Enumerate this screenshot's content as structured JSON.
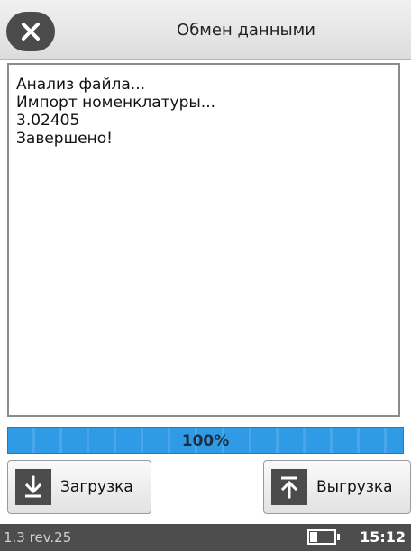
{
  "header": {
    "title": "Обмен данными",
    "close_icon": "close-icon"
  },
  "log": {
    "lines": [
      "Анализ файла...",
      "Импорт номенклатуры...",
      "3.02405",
      "Завершено!"
    ]
  },
  "progress": {
    "value": 100,
    "label": "100%",
    "color": "#2f9ae6"
  },
  "buttons": {
    "download": {
      "label": "Загрузка",
      "icon": "download-icon"
    },
    "upload": {
      "label": "Выгрузка",
      "icon": "upload-icon"
    }
  },
  "status_bar": {
    "version": "1.3 rev.25",
    "battery_level": 0.3,
    "time": "15:12"
  }
}
